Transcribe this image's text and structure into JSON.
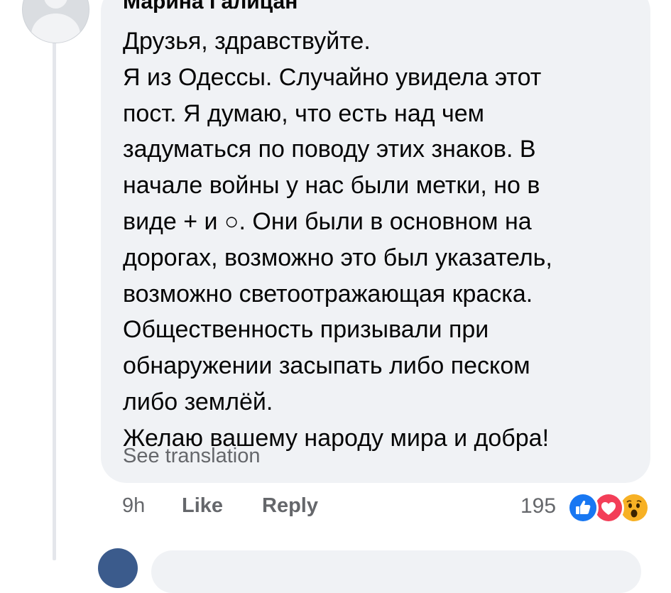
{
  "comment": {
    "author": "Марина Галицан",
    "lines": [
      "Друзья, здравствуйте.",
      "Я из Одессы. Случайно увидела этот",
      "пост. Я думаю, что есть над чем",
      "задуматься по поводу этих знаков. В",
      "начале войны у нас были метки, но в",
      "виде + и ○. Они были в основном на",
      "дорогах, возможно это был указатель,",
      "возможно светоотражающая краска.",
      "Общественность призывали при",
      "обнаружении засыпать либо песком",
      "либо землёй.",
      "Желаю вашему народу мира и добра!"
    ],
    "see_translation": "See translation"
  },
  "actions": {
    "time": "9h",
    "like": "Like",
    "reply": "Reply"
  },
  "reactions": {
    "count": "195",
    "icons": [
      "like-reaction-icon",
      "love-reaction-icon",
      "wow-reaction-icon"
    ]
  },
  "colors": {
    "bubble_bg": "#f0f2f5",
    "secondary_text": "#65676b",
    "primary_text": "#050505",
    "like_blue": "#1877f2",
    "love_red": "#f33e58",
    "wow_yellow": "#f7b125"
  }
}
